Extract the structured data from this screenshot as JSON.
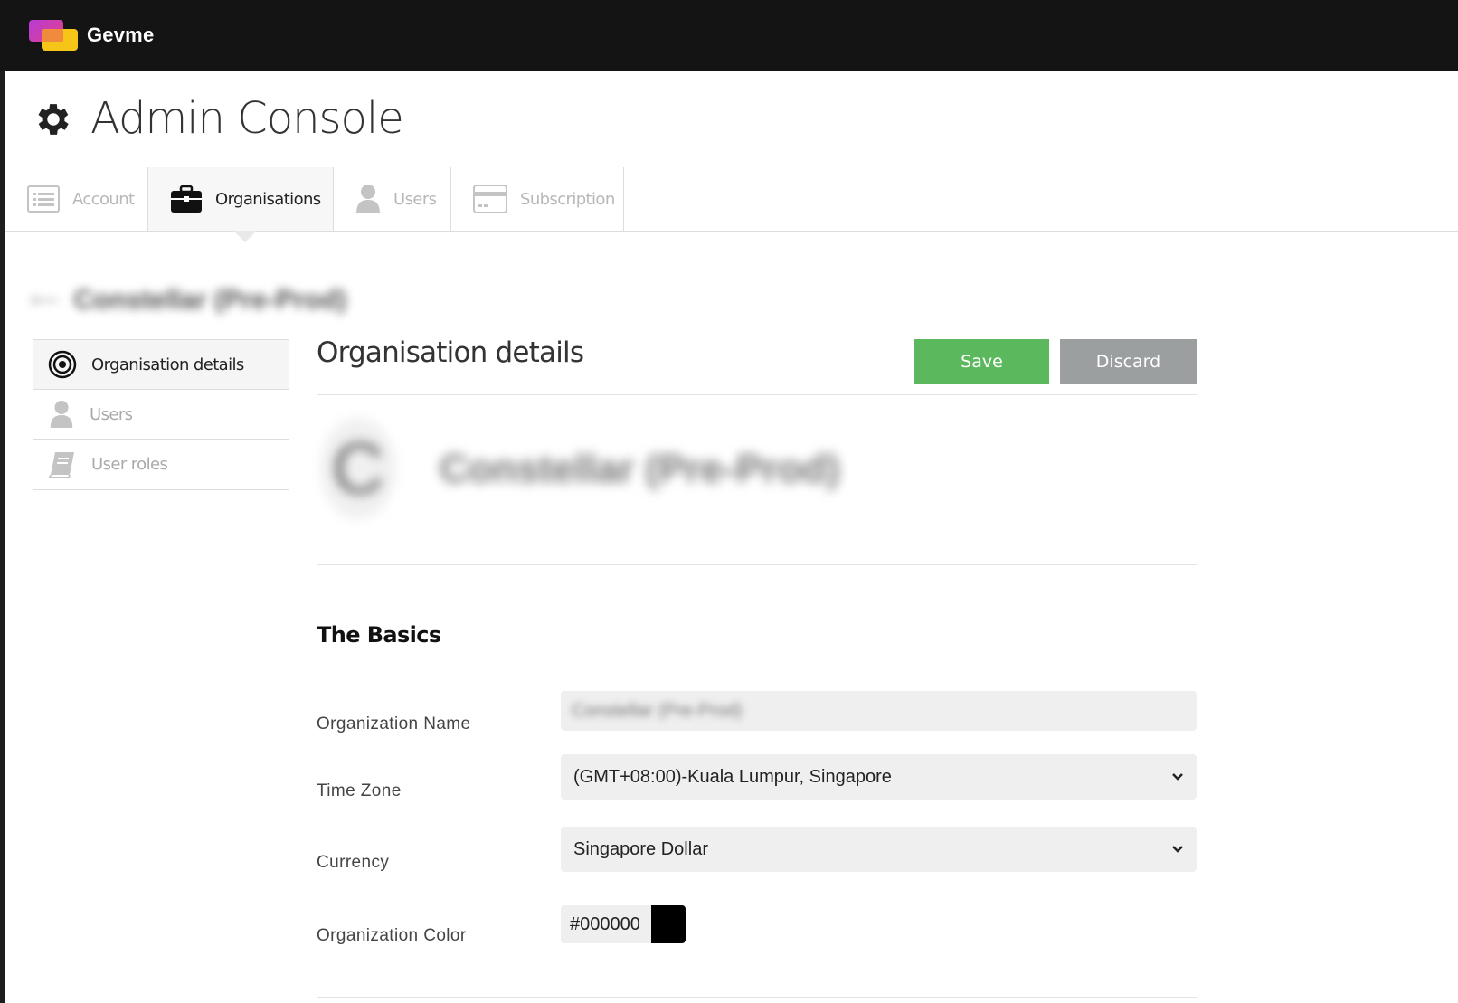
{
  "app": {
    "brand": "Gevme",
    "title": "Admin Console"
  },
  "tabs": [
    {
      "label": "Account",
      "icon": "list-icon",
      "active": false
    },
    {
      "label": "Organisations",
      "icon": "briefcase-icon",
      "active": true
    },
    {
      "label": "Users",
      "icon": "user-icon",
      "active": false
    },
    {
      "label": "Subscription",
      "icon": "credit-card-icon",
      "active": false
    }
  ],
  "breadcrumb": {
    "back": "⟵",
    "org": "Constellar (Pre-Prod)"
  },
  "sidenav": [
    {
      "label": "Organisation details",
      "icon": "target-icon",
      "active": true
    },
    {
      "label": "Users",
      "icon": "user-icon",
      "active": false
    },
    {
      "label": "User roles",
      "icon": "book-icon",
      "active": false
    }
  ],
  "main": {
    "title": "Organisation details",
    "save_label": "Save",
    "discard_label": "Discard",
    "org_initial": "C",
    "org_name": "Constellar (Pre-Prod)",
    "basics_title": "The Basics",
    "fields": {
      "org_name_label": "Organization Name",
      "org_name_value": "Constellar (Pre-Prod)",
      "timezone_label": "Time Zone",
      "timezone_value": "(GMT+08:00)-Kuala Lumpur, Singapore",
      "currency_label": "Currency",
      "currency_value": "Singapore Dollar",
      "color_label": "Organization Color",
      "color_value": "#000000"
    }
  },
  "colors": {
    "save": "#5cb85c",
    "discard": "#9b9fa0",
    "topbar": "#141414"
  }
}
